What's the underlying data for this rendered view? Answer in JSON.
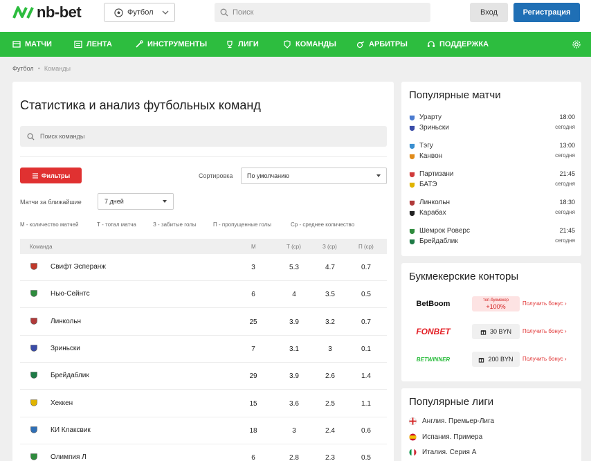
{
  "header": {
    "logo_text": "nb-bet",
    "sport_select": "Футбол",
    "search_placeholder": "Поиск",
    "login_label": "Вход",
    "register_label": "Регистрация"
  },
  "nav": [
    {
      "label": "МАТЧИ",
      "icon": "matches-icon"
    },
    {
      "label": "ЛЕНТА",
      "icon": "feed-icon"
    },
    {
      "label": "ИНСТРУМЕНТЫ",
      "icon": "tools-icon"
    },
    {
      "label": "ЛИГИ",
      "icon": "trophy-icon"
    },
    {
      "label": "КОМАНДЫ",
      "icon": "teams-icon"
    },
    {
      "label": "АРБИТРЫ",
      "icon": "whistle-icon"
    },
    {
      "label": "ПОДДЕРЖКА",
      "icon": "headset-icon"
    }
  ],
  "breadcrumb": {
    "root": "Футбол",
    "current": "Команды"
  },
  "main": {
    "title": "Статистика и анализ футбольных команд",
    "team_search_placeholder": "Поиск команды",
    "filter_label": "Фильтры",
    "sort_label": "Сортировка",
    "sort_value": "По умолчанию",
    "days_label": "Матчи за ближайшие",
    "days_value": "7 дней",
    "legend": [
      "М - количество матчей",
      "Т - тотал матча",
      "З - забитые голы",
      "П - пропущенные голы",
      "Ср - среднее количество"
    ],
    "columns": [
      "Команда",
      "М",
      "Т (ср)",
      "З (ср)",
      "П (ср)"
    ],
    "rows": [
      {
        "team": "Свифт Эсперанж",
        "m": "3",
        "t": "5.3",
        "z": "4.7",
        "p": "0.7",
        "color": "#c0392b"
      },
      {
        "team": "Нью-Сейнтс",
        "m": "6",
        "t": "4",
        "z": "3.5",
        "p": "0.5",
        "color": "#2e8b3d"
      },
      {
        "team": "Линкольн",
        "m": "25",
        "t": "3.9",
        "z": "3.2",
        "p": "0.7",
        "color": "#b03a3a"
      },
      {
        "team": "Зриньски",
        "m": "7",
        "t": "3.1",
        "z": "3",
        "p": "0.1",
        "color": "#3a4ca8"
      },
      {
        "team": "Брейдаблик",
        "m": "29",
        "t": "3.9",
        "z": "2.6",
        "p": "1.4",
        "color": "#1e7a46"
      },
      {
        "team": "Хеккен",
        "m": "15",
        "t": "3.6",
        "z": "2.5",
        "p": "1.1",
        "color": "#e0b400"
      },
      {
        "team": "КИ Клаксвик",
        "m": "18",
        "t": "3",
        "z": "2.4",
        "p": "0.6",
        "color": "#2f6fb5"
      },
      {
        "team": "Олимпия Л",
        "m": "6",
        "t": "2.8",
        "z": "2.3",
        "p": "0.5",
        "color": "#2e8b3d"
      }
    ]
  },
  "popular_matches": {
    "title": "Популярные матчи",
    "items": [
      {
        "home": "Урарту",
        "away": "Зриньски",
        "time": "18:00",
        "day": "сегодня",
        "home_color": "#4a7bd0",
        "away_color": "#3a4ca8"
      },
      {
        "home": "Тэгу",
        "away": "Канвон",
        "time": "13:00",
        "day": "сегодня",
        "home_color": "#3a8fd0",
        "away_color": "#e08b1a"
      },
      {
        "home": "Партизани",
        "away": "БАТЭ",
        "time": "21:45",
        "day": "сегодня",
        "home_color": "#d03a3a",
        "away_color": "#e0b400"
      },
      {
        "home": "Линкольн",
        "away": "Карабах",
        "time": "18:30",
        "day": "сегодня",
        "home_color": "#b03a3a",
        "away_color": "#222222"
      },
      {
        "home": "Шемрок Роверс",
        "away": "Брейдаблик",
        "time": "21:45",
        "day": "сегодня",
        "home_color": "#2e8b3d",
        "away_color": "#1e7a46"
      }
    ]
  },
  "bookmakers": {
    "title": "Букмекерские конторы",
    "items": [
      {
        "name": "BetBoom",
        "badge_top": "топ-букмекер",
        "badge": "+100%",
        "link": "Получить бонус",
        "style": "red"
      },
      {
        "name": "FONBET",
        "badge_top": "",
        "badge": "30 BYN",
        "link": "Получить бонус",
        "style": "grey"
      },
      {
        "name": "BETWINNER",
        "badge_top": "",
        "badge": "200 BYN",
        "link": "Получить бонус",
        "style": "grey"
      }
    ]
  },
  "popular_leagues": {
    "title": "Популярные лиги",
    "items": [
      {
        "label": "Англия. Премьер-Лига",
        "flag": "england-flag-icon"
      },
      {
        "label": "Испания. Примера",
        "flag": "spain-flag-icon"
      },
      {
        "label": "Италия. Серия А",
        "flag": "italy-flag-icon"
      }
    ]
  },
  "colors": {
    "green": "#2dbd3f",
    "blue": "#1f6fb5",
    "red": "#e03131"
  }
}
